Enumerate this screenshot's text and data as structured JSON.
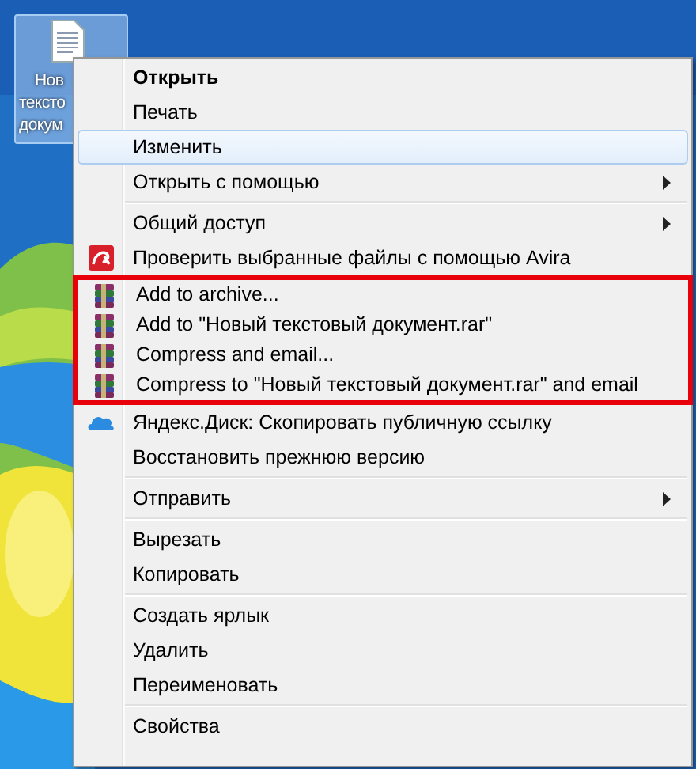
{
  "desktop_icon": {
    "label_lines": [
      "Нов",
      "тексто",
      "докум"
    ],
    "selected": true
  },
  "menu": {
    "sections": [
      {
        "items": [
          {
            "kind": "command",
            "label": "Открыть",
            "default": true,
            "selected": false,
            "submenu": false
          },
          {
            "kind": "command",
            "label": "Печать",
            "default": false,
            "selected": false,
            "submenu": false
          },
          {
            "kind": "command",
            "label": "Изменить",
            "default": false,
            "selected": true,
            "submenu": false
          },
          {
            "kind": "command",
            "label": "Открыть с помощью",
            "default": false,
            "selected": false,
            "submenu": true
          }
        ]
      },
      {
        "items": [
          {
            "kind": "command",
            "label": "Общий доступ",
            "default": false,
            "selected": false,
            "submenu": true
          },
          {
            "label": "Проверить выбранные файлы с помощью Avira",
            "default": false,
            "selected": false,
            "submenu": false,
            "kind": "avira"
          },
          {
            "kind": "highlight",
            "items": [
              {
                "label": "Add to archive...",
                "default": false,
                "selected": false,
                "submenu": false,
                "kind": "archive"
              },
              {
                "label": "Add to \"Новый текстовый документ.rar\"",
                "default": false,
                "selected": false,
                "submenu": false,
                "kind": "archive"
              },
              {
                "label": "Compress and email...",
                "default": false,
                "selected": false,
                "submenu": false,
                "kind": "archive"
              },
              {
                "label": "Compress to \"Новый текстовый документ.rar\" and email",
                "default": false,
                "selected": false,
                "submenu": false,
                "kind": "archive"
              }
            ]
          },
          {
            "label": "Яндекс.Диск: Скопировать публичную ссылку",
            "default": false,
            "selected": false,
            "submenu": false,
            "kind": "cloud"
          },
          {
            "kind": "command",
            "label": "Восстановить прежнюю версию",
            "default": false,
            "selected": false,
            "submenu": false
          }
        ]
      },
      {
        "items": [
          {
            "kind": "command",
            "label": "Отправить",
            "default": false,
            "selected": false,
            "submenu": true
          }
        ]
      },
      {
        "items": [
          {
            "kind": "command",
            "label": "Вырезать",
            "default": false,
            "selected": false,
            "submenu": false
          },
          {
            "kind": "command",
            "label": "Копировать",
            "default": false,
            "selected": false,
            "submenu": false
          }
        ]
      },
      {
        "items": [
          {
            "kind": "command",
            "label": "Создать ярлык",
            "default": false,
            "selected": false,
            "submenu": false
          },
          {
            "kind": "command",
            "label": "Удалить",
            "default": false,
            "selected": false,
            "submenu": false
          },
          {
            "kind": "command",
            "label": "Переименовать",
            "default": false,
            "selected": false,
            "submenu": false
          }
        ]
      },
      {
        "items": [
          {
            "kind": "command",
            "label": "Свойства",
            "default": false,
            "selected": false,
            "submenu": false
          }
        ]
      }
    ]
  }
}
